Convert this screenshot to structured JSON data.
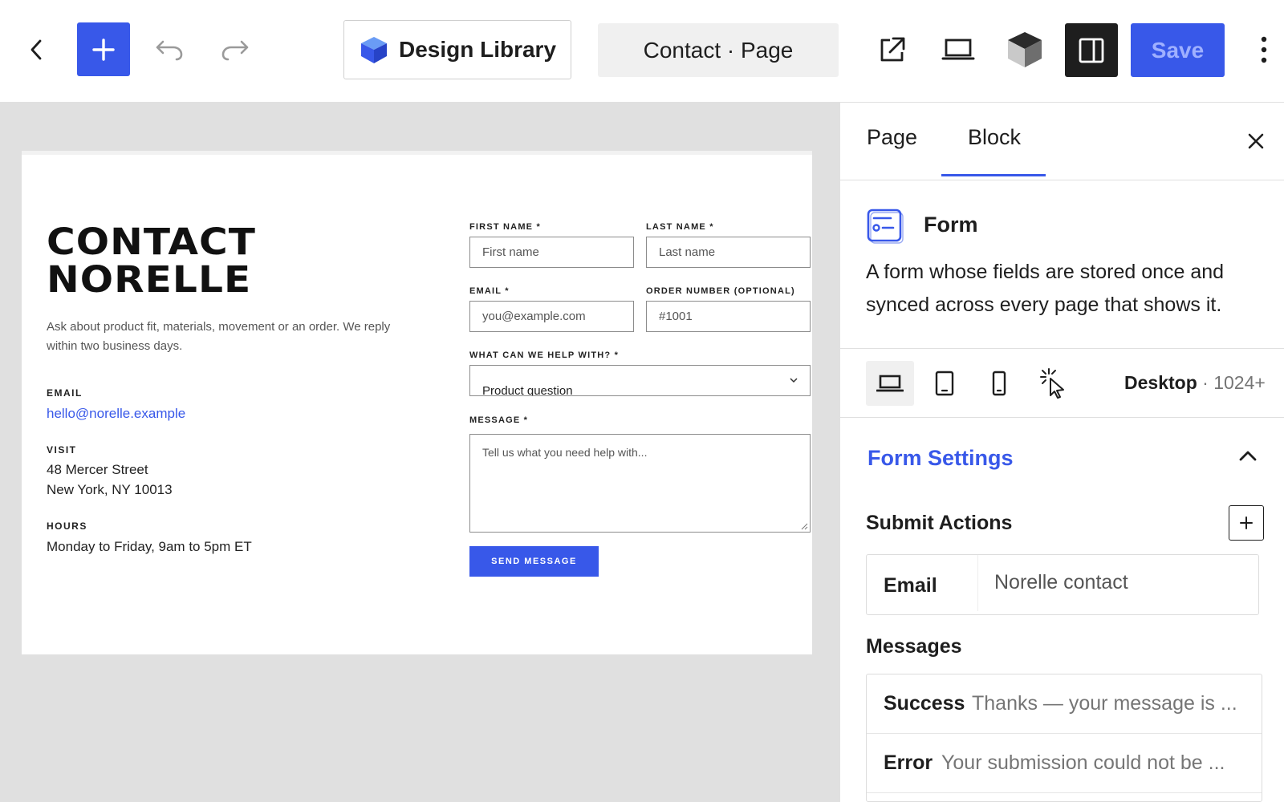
{
  "toolbar": {
    "design_library_label": "Design Library",
    "document_title": "Contact · Page",
    "save_label": "Save"
  },
  "canvas": {
    "heading_line1": "CONTACT",
    "heading_line2": "NORELLE",
    "intro": "Ask about product fit, materials, movement or an order. We reply within two business days.",
    "info": {
      "email_label": "EMAIL",
      "email_value": "hello@norelle.example",
      "visit_label": "VISIT",
      "visit_line1": "48 Mercer Street",
      "visit_line2": "New York, NY 10013",
      "hours_label": "HOURS",
      "hours_value": "Monday to Friday, 9am to 5pm ET"
    },
    "form": {
      "first_name_label": "FIRST NAME *",
      "first_name_placeholder": "First name",
      "last_name_label": "LAST NAME *",
      "last_name_placeholder": "Last name",
      "email_label": "EMAIL *",
      "email_placeholder": "you@example.com",
      "order_label": "ORDER NUMBER (OPTIONAL)",
      "order_placeholder": "#1001",
      "help_label": "WHAT CAN WE HELP WITH? *",
      "help_value": "Product question",
      "message_label": "MESSAGE *",
      "message_placeholder": "Tell us what you need help with...",
      "send_label": "SEND MESSAGE"
    }
  },
  "sidebar": {
    "tabs": [
      {
        "label": "Page",
        "active": false
      },
      {
        "label": "Block",
        "active": true
      }
    ],
    "block": {
      "name": "Form",
      "description": "A form whose fields are stored once and synced across every page that shows it."
    },
    "device": {
      "current": "Desktop",
      "range": "1024+"
    },
    "form_settings": {
      "title": "Form Settings",
      "submit_actions_label": "Submit Actions",
      "actions": [
        {
          "type": "Email",
          "name": "Norelle contact"
        }
      ],
      "messages_label": "Messages",
      "messages": [
        {
          "label": "Success",
          "value": "Thanks — your message is ..."
        },
        {
          "label": "Error",
          "value": "Your submission could not be ..."
        }
      ]
    }
  },
  "colors": {
    "accent": "#3858e9",
    "canvas_bg": "#e0e0e0",
    "dark": "#1e1e1e"
  },
  "icons": {
    "back": "chevron-left-icon",
    "add": "plus-icon",
    "undo": "undo-icon",
    "redo": "redo-icon",
    "design_library": "cube-icon",
    "view": "external-link-icon",
    "device": "laptop-icon",
    "sidebar": "sidebar-toggle-icon",
    "more": "more-vertical-icon"
  }
}
